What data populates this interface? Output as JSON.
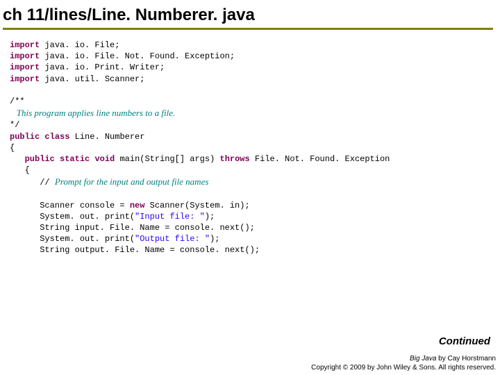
{
  "title": "ch 11/lines/Line. Numberer. java",
  "code": {
    "kw_import": "import",
    "imp1": " java. io. File;",
    "imp2": " java. io. File. Not. Found. Exception;",
    "imp3": " java. io. Print. Writer;",
    "imp4": " java. util. Scanner;",
    "doc_open": "/**",
    "doc_body": "   This program applies line numbers to a file.",
    "doc_close": "*/",
    "kw_public": "public",
    "kw_class": "class",
    "class_name": " Line. Numberer",
    "brace_open": "{",
    "kw_static": "static",
    "kw_void": "void",
    "main_sig": " main(String[] args) ",
    "kw_throws": "throws",
    "throws_clause": " File. Not. Found. Exception",
    "indent3": "   ",
    "brace_open2": "   {",
    "comment_lead": "      // ",
    "comment_text": "Prompt for the input and output file names",
    "blank": "",
    "line_scanner_a": "      Scanner console = ",
    "kw_new": "new",
    "line_scanner_b": " Scanner(System. in);",
    "line_p1a": "      System. out. print(",
    "str_input": "\"Input file: \"",
    "line_p1b": ");",
    "line_in": "      String input. File. Name = console. next();",
    "line_p2a": "      System. out. print(",
    "str_output": "\"Output file: \"",
    "line_p2b": ");",
    "line_out": "      String output. File. Name = console. next();"
  },
  "continued": "Continued",
  "footer": {
    "book": "Big Java",
    "by": " by Cay Horstmann",
    "copy": "Copyright © 2009 by John Wiley & Sons.  All rights reserved."
  }
}
